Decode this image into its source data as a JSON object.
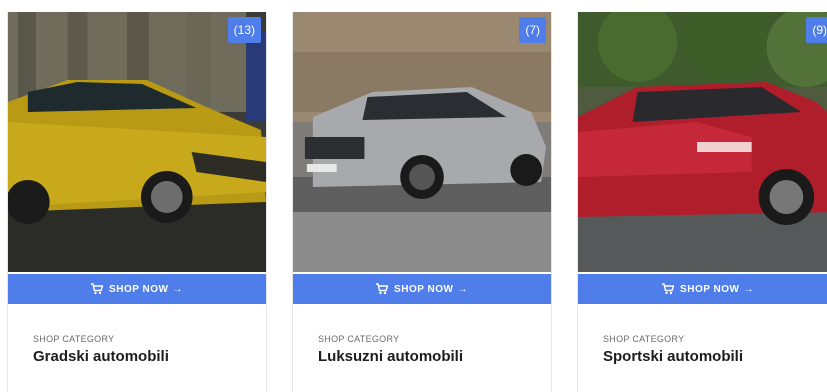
{
  "colors": {
    "accent": "#4f7de9"
  },
  "cards": [
    {
      "count": "(13)",
      "button_label": "SHOP NOW",
      "button_arrow": "→",
      "cart_icon": "cart-icon",
      "category_label": "SHOP CATEGORY",
      "title": "Gradski automobili"
    },
    {
      "count": "(7)",
      "button_label": "SHOP NOW",
      "button_arrow": "→",
      "cart_icon": "cart-icon",
      "category_label": "SHOP CATEGORY",
      "title": "Luksuzni automobili"
    },
    {
      "count": "(9)",
      "button_label": "SHOP NOW",
      "button_arrow": "→",
      "cart_icon": "cart-icon",
      "category_label": "SHOP CATEGORY",
      "title": "Sportski automobili"
    }
  ]
}
